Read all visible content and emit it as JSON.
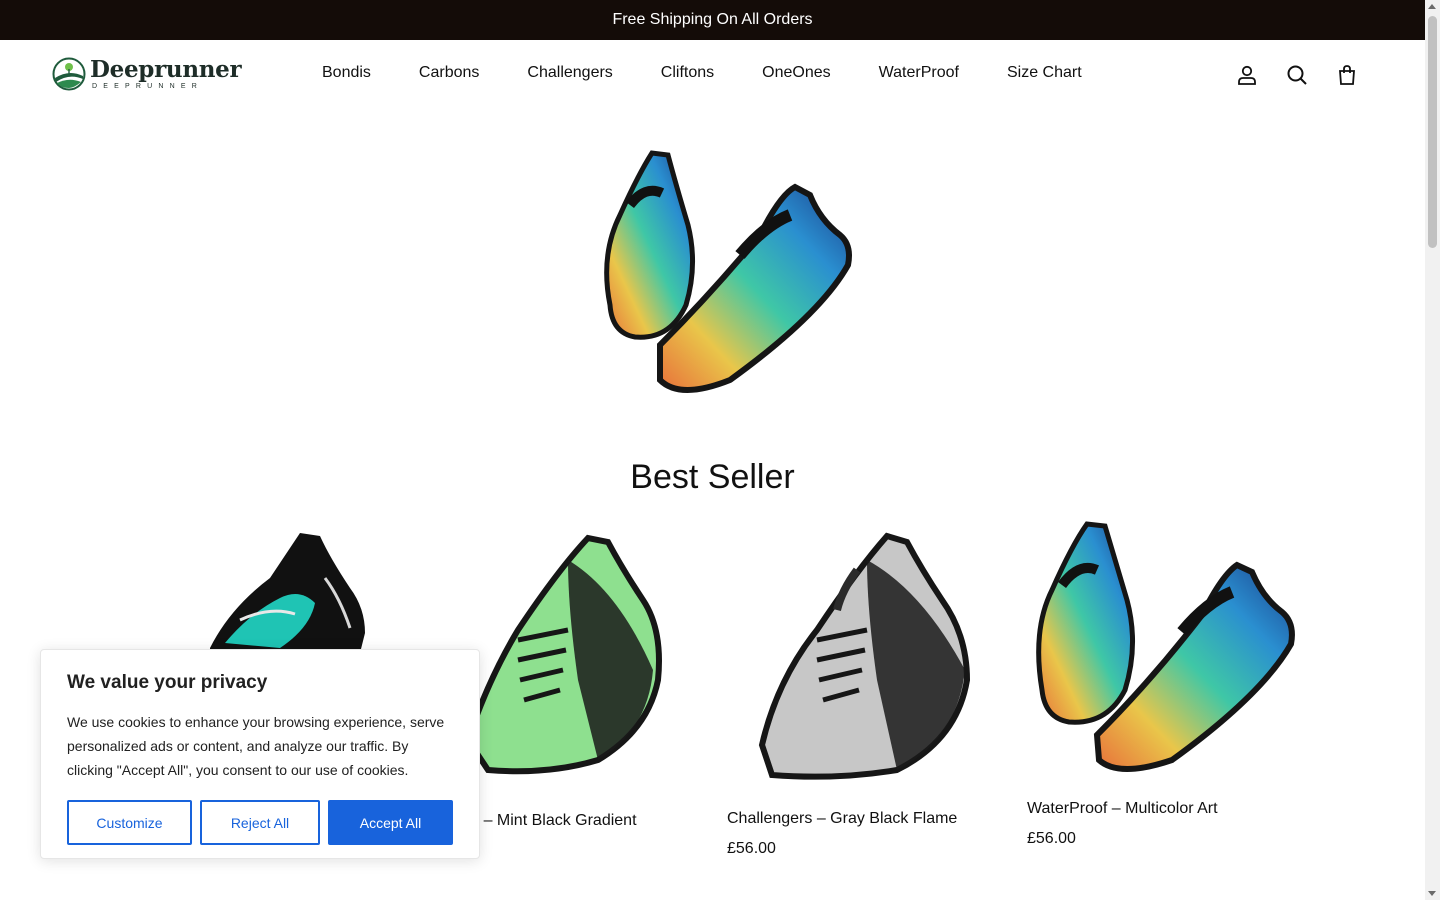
{
  "announcement": "Free Shipping On All Orders",
  "brand": {
    "name": "Deeprunner",
    "tagline": "DEEPRUNNER"
  },
  "nav": [
    "Bondis",
    "Carbons",
    "Challengers",
    "Cliftons",
    "OneOnes",
    "WaterProof",
    "Size Chart"
  ],
  "header_icons": [
    "account-icon",
    "search-icon",
    "cart-icon"
  ],
  "section_title": "Best Seller",
  "products": [
    {
      "name": "",
      "price": "",
      "colors": [
        "#1fc4b4",
        "#111111"
      ]
    },
    {
      "name": "gers – Mint Black Gradient",
      "price": "",
      "colors": [
        "#8ee08f",
        "#1a1a1a"
      ]
    },
    {
      "name": "Challengers – Gray Black Flame",
      "price": "£56.00",
      "colors": [
        "#c7c7c7",
        "#1a1a1a"
      ]
    },
    {
      "name": "WaterProof – Multicolor Art",
      "price": "£56.00",
      "colors": [
        "#2ab5a8",
        "#1a1a1a"
      ]
    }
  ],
  "cookie": {
    "title": "We value your privacy",
    "body": "We use cookies to enhance your browsing experience, serve personalized ads or content, and analyze our traffic. By clicking \"Accept All\", you consent to our use of cookies.",
    "customize": "Customize",
    "reject": "Reject All",
    "accept": "Accept All"
  },
  "colors": {
    "announcement_bg": "#140c08",
    "accent": "#1863dc"
  }
}
